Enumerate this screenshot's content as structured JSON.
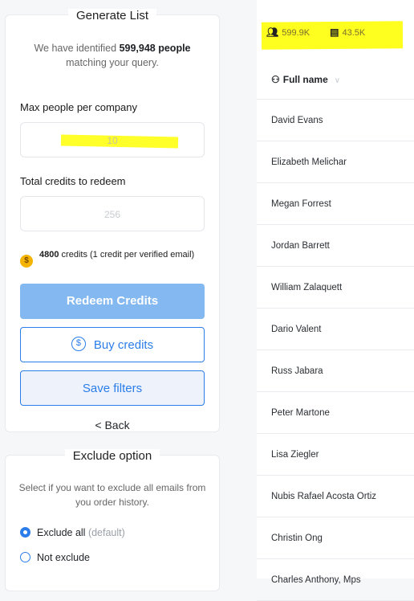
{
  "generate": {
    "title": "Generate List",
    "identified_prefix": "We have identified ",
    "identified_count": "599,948 people",
    "identified_suffix": "matching your query.",
    "max_label": "Max people per company",
    "max_value": "10",
    "total_label": "Total credits to redeem",
    "total_value": "256",
    "credits_amount": "4800",
    "credits_text": " credits (1 credit per verified email)",
    "coin_symbol": "$",
    "redeem_label": "Redeem Credits",
    "buy_label": "Buy credits",
    "buy_icon_symbol": "$",
    "save_label": "Save filters",
    "back_label": "< Back"
  },
  "exclude": {
    "title": "Exclude option",
    "description": "Select if you want to exclude all emails from you order history.",
    "option1": "Exclude all",
    "option1_note": "(default)",
    "option2": "Not exclude",
    "selected": "Exclude all"
  },
  "stats": {
    "people_count": "599.9K",
    "company_count": "43.5K"
  },
  "table": {
    "header_label": "Full name",
    "rows": [
      "David Evans",
      "Elizabeth Melichar",
      "Megan Forrest",
      "Jordan Barrett",
      "William Zalaquett",
      "Dario Valent",
      "Russ Jabara",
      "Peter Martone",
      "Lisa Ziegler",
      "Nubis Rafael Acosta Ortiz",
      "Christin Ong",
      "Charles Anthony, Mps"
    ]
  },
  "colors": {
    "accent": "#2b7de9",
    "highlight": "#ffff1f",
    "redeem_disabled": "#84b8f0"
  }
}
